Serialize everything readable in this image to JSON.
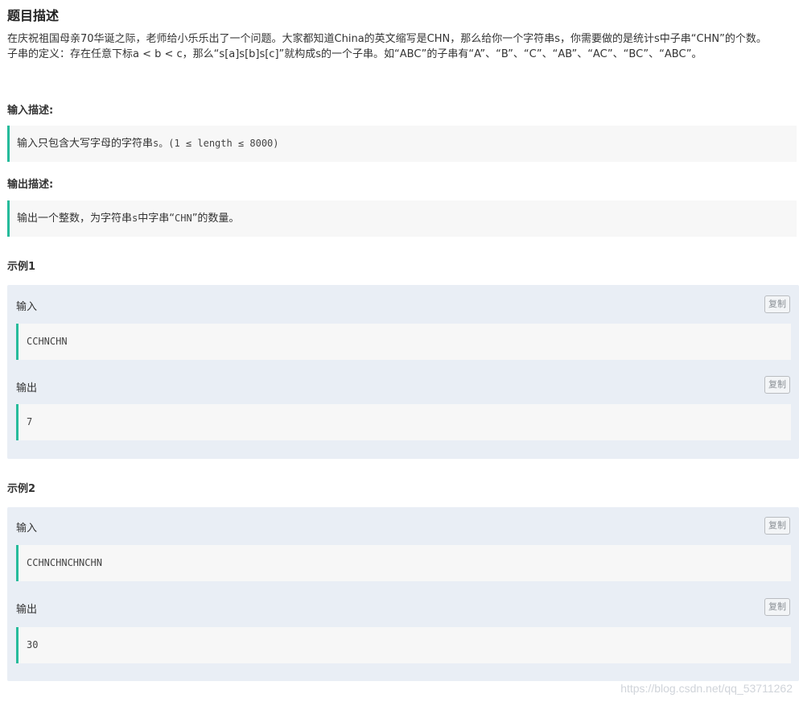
{
  "title": "题目描述",
  "description": {
    "line1": "在庆祝祖国母亲70华诞之际，老师给小乐乐出了一个问题。大家都知道China的英文缩写是CHN，那么给你一个字符串s，你需要做的是统计s中子串“CHN”的个数。",
    "line2": "子串的定义：存在任意下标a < b < c，那么“s[a]s[b]s[c]”就构成s的一个子串。如“ABC”的子串有“A”、“B”、“C”、“AB”、“AC”、“BC”、“ABC”。"
  },
  "input_section": {
    "label": "输入描述:",
    "text_prefix": "输入只包含大写字母的字符串",
    "text_mono": "s。(1 ≤ length ≤ 8000)"
  },
  "output_section": {
    "label": "输出描述:",
    "text_prefix": "输出一个整数，为字符串",
    "text_mono_s": "s",
    "text_mid": "中字串“",
    "text_mono_chn": "CHN",
    "text_suffix": "”的数量。"
  },
  "examples": [
    {
      "label": "示例1",
      "input_label": "输入",
      "input_value": "CCHNCHN",
      "output_label": "输出",
      "output_value": "7",
      "copy_label": "复制"
    },
    {
      "label": "示例2",
      "input_label": "输入",
      "input_value": "CCHNCHNCHNCHN",
      "output_label": "输出",
      "output_value": "30",
      "copy_label": "复制"
    }
  ],
  "watermark": "https://blog.csdn.net/qq_53711262",
  "colors": {
    "accent_border": "#25bb9b",
    "example_bg": "#e9eef5",
    "code_bg": "#f7f7f7"
  }
}
